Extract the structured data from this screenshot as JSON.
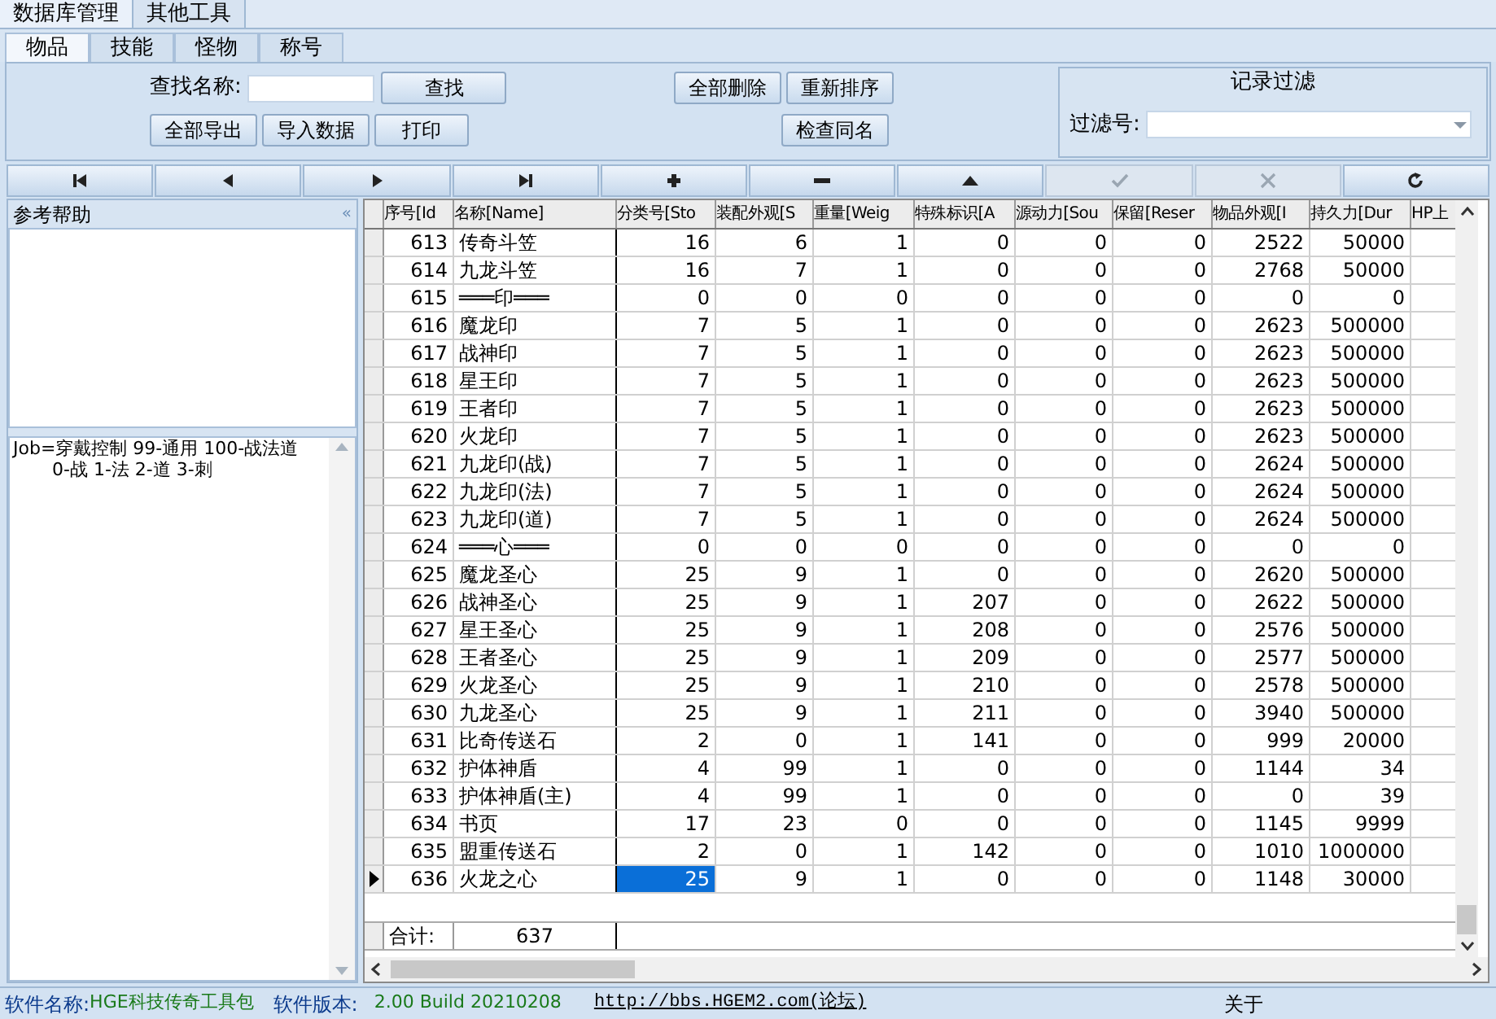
{
  "main_tabs": [
    {
      "label": "数据库管理",
      "selected": true
    },
    {
      "label": "其他工具",
      "selected": false
    }
  ],
  "sub_tabs": [
    {
      "label": "物品",
      "selected": true
    },
    {
      "label": "技能",
      "selected": false
    },
    {
      "label": "怪物",
      "selected": false
    },
    {
      "label": "称号",
      "selected": false
    }
  ],
  "toolbar": {
    "search_label": "查找名称:",
    "search_button": "查找",
    "buttons_row1": [
      "全部删除",
      "重新排序"
    ],
    "buttons_row2": [
      "全部导出",
      "导入数据",
      "打印"
    ],
    "check_button": "检查同名",
    "filter": {
      "title": "记录过滤",
      "label": "过滤号:"
    }
  },
  "nav_buttons": [
    {
      "kind": "first",
      "disabled": false
    },
    {
      "kind": "prev",
      "disabled": false
    },
    {
      "kind": "next",
      "disabled": false
    },
    {
      "kind": "last",
      "disabled": false
    },
    {
      "kind": "add",
      "disabled": false
    },
    {
      "kind": "delete",
      "disabled": false
    },
    {
      "kind": "up",
      "disabled": false
    },
    {
      "kind": "post",
      "disabled": true
    },
    {
      "kind": "cancel",
      "disabled": true
    },
    {
      "kind": "refresh",
      "disabled": false
    }
  ],
  "help_panel": {
    "title": "参考帮助",
    "collapse": "«",
    "lines": [
      "Job=穿戴控制 99-通用 100-战法道",
      "0-战 1-法 2-道 3-刺"
    ]
  },
  "table": {
    "columns": [
      {
        "label": "序号[Id",
        "focused": false
      },
      {
        "label": "名称[Name]",
        "focused": false
      },
      {
        "label": "分类号[Sto",
        "focused": true
      },
      {
        "label": "装配外观[S",
        "focused": false
      },
      {
        "label": "重量[Weig",
        "focused": false
      },
      {
        "label": "特殊标识[A",
        "focused": false
      },
      {
        "label": "源动力[Sou",
        "focused": false
      },
      {
        "label": "保留[Reser",
        "focused": false
      },
      {
        "label": "物品外观[I",
        "focused": false
      },
      {
        "label": "持久力[Dur",
        "focused": false
      },
      {
        "label": "HP上",
        "focused": false
      }
    ],
    "rows": [
      {
        "selected": false,
        "cells": [
          "613",
          "传奇斗笠",
          "16",
          "6",
          "1",
          "0",
          "0",
          "0",
          "2522",
          "50000"
        ]
      },
      {
        "selected": false,
        "cells": [
          "614",
          "九龙斗笠",
          "16",
          "7",
          "1",
          "0",
          "0",
          "0",
          "2768",
          "50000"
        ]
      },
      {
        "selected": false,
        "cells": [
          "615",
          "═══印═══",
          "0",
          "0",
          "0",
          "0",
          "0",
          "0",
          "0",
          "0"
        ]
      },
      {
        "selected": false,
        "cells": [
          "616",
          "魔龙印",
          "7",
          "5",
          "1",
          "0",
          "0",
          "0",
          "2623",
          "500000"
        ]
      },
      {
        "selected": false,
        "cells": [
          "617",
          "战神印",
          "7",
          "5",
          "1",
          "0",
          "0",
          "0",
          "2623",
          "500000"
        ]
      },
      {
        "selected": false,
        "cells": [
          "618",
          "星王印",
          "7",
          "5",
          "1",
          "0",
          "0",
          "0",
          "2623",
          "500000"
        ]
      },
      {
        "selected": false,
        "cells": [
          "619",
          "王者印",
          "7",
          "5",
          "1",
          "0",
          "0",
          "0",
          "2623",
          "500000"
        ]
      },
      {
        "selected": false,
        "cells": [
          "620",
          "火龙印",
          "7",
          "5",
          "1",
          "0",
          "0",
          "0",
          "2623",
          "500000"
        ]
      },
      {
        "selected": false,
        "cells": [
          "621",
          "九龙印(战)",
          "7",
          "5",
          "1",
          "0",
          "0",
          "0",
          "2624",
          "500000"
        ]
      },
      {
        "selected": false,
        "cells": [
          "622",
          "九龙印(法)",
          "7",
          "5",
          "1",
          "0",
          "0",
          "0",
          "2624",
          "500000"
        ]
      },
      {
        "selected": false,
        "cells": [
          "623",
          "九龙印(道)",
          "7",
          "5",
          "1",
          "0",
          "0",
          "0",
          "2624",
          "500000"
        ]
      },
      {
        "selected": false,
        "cells": [
          "624",
          "═══心═══",
          "0",
          "0",
          "0",
          "0",
          "0",
          "0",
          "0",
          "0"
        ]
      },
      {
        "selected": false,
        "cells": [
          "625",
          "魔龙圣心",
          "25",
          "9",
          "1",
          "0",
          "0",
          "0",
          "2620",
          "500000"
        ]
      },
      {
        "selected": false,
        "cells": [
          "626",
          "战神圣心",
          "25",
          "9",
          "1",
          "207",
          "0",
          "0",
          "2622",
          "500000"
        ]
      },
      {
        "selected": false,
        "cells": [
          "627",
          "星王圣心",
          "25",
          "9",
          "1",
          "208",
          "0",
          "0",
          "2576",
          "500000"
        ]
      },
      {
        "selected": false,
        "cells": [
          "628",
          "王者圣心",
          "25",
          "9",
          "1",
          "209",
          "0",
          "0",
          "2577",
          "500000"
        ]
      },
      {
        "selected": false,
        "cells": [
          "629",
          "火龙圣心",
          "25",
          "9",
          "1",
          "210",
          "0",
          "0",
          "2578",
          "500000"
        ]
      },
      {
        "selected": false,
        "cells": [
          "630",
          "九龙圣心",
          "25",
          "9",
          "1",
          "211",
          "0",
          "0",
          "3940",
          "500000"
        ]
      },
      {
        "selected": false,
        "cells": [
          "631",
          "比奇传送石",
          "2",
          "0",
          "1",
          "141",
          "0",
          "0",
          "999",
          "20000"
        ]
      },
      {
        "selected": false,
        "cells": [
          "632",
          "护体神盾",
          "4",
          "99",
          "1",
          "0",
          "0",
          "0",
          "1144",
          "34"
        ]
      },
      {
        "selected": false,
        "cells": [
          "633",
          "护体神盾(主)",
          "4",
          "99",
          "1",
          "0",
          "0",
          "0",
          "0",
          "39"
        ]
      },
      {
        "selected": false,
        "cells": [
          "634",
          "书页",
          "17",
          "23",
          "0",
          "0",
          "0",
          "0",
          "1145",
          "9999"
        ]
      },
      {
        "selected": false,
        "cells": [
          "635",
          "盟重传送石",
          "2",
          "0",
          "1",
          "142",
          "0",
          "0",
          "1010",
          "1000000"
        ]
      },
      {
        "selected": true,
        "cells": [
          "636",
          "火龙之心",
          "25",
          "9",
          "1",
          "0",
          "0",
          "0",
          "1148",
          "30000"
        ]
      }
    ],
    "footer": {
      "label": "合计:",
      "count": "637"
    }
  },
  "status_bar": {
    "name_label": "软件名称:",
    "name": "HGE科技传奇工具包",
    "version_label": "软件版本:",
    "version": "2.00 Build 20210208",
    "link": "http://bbs.HGEM2.com(论坛)",
    "about": "关于"
  }
}
